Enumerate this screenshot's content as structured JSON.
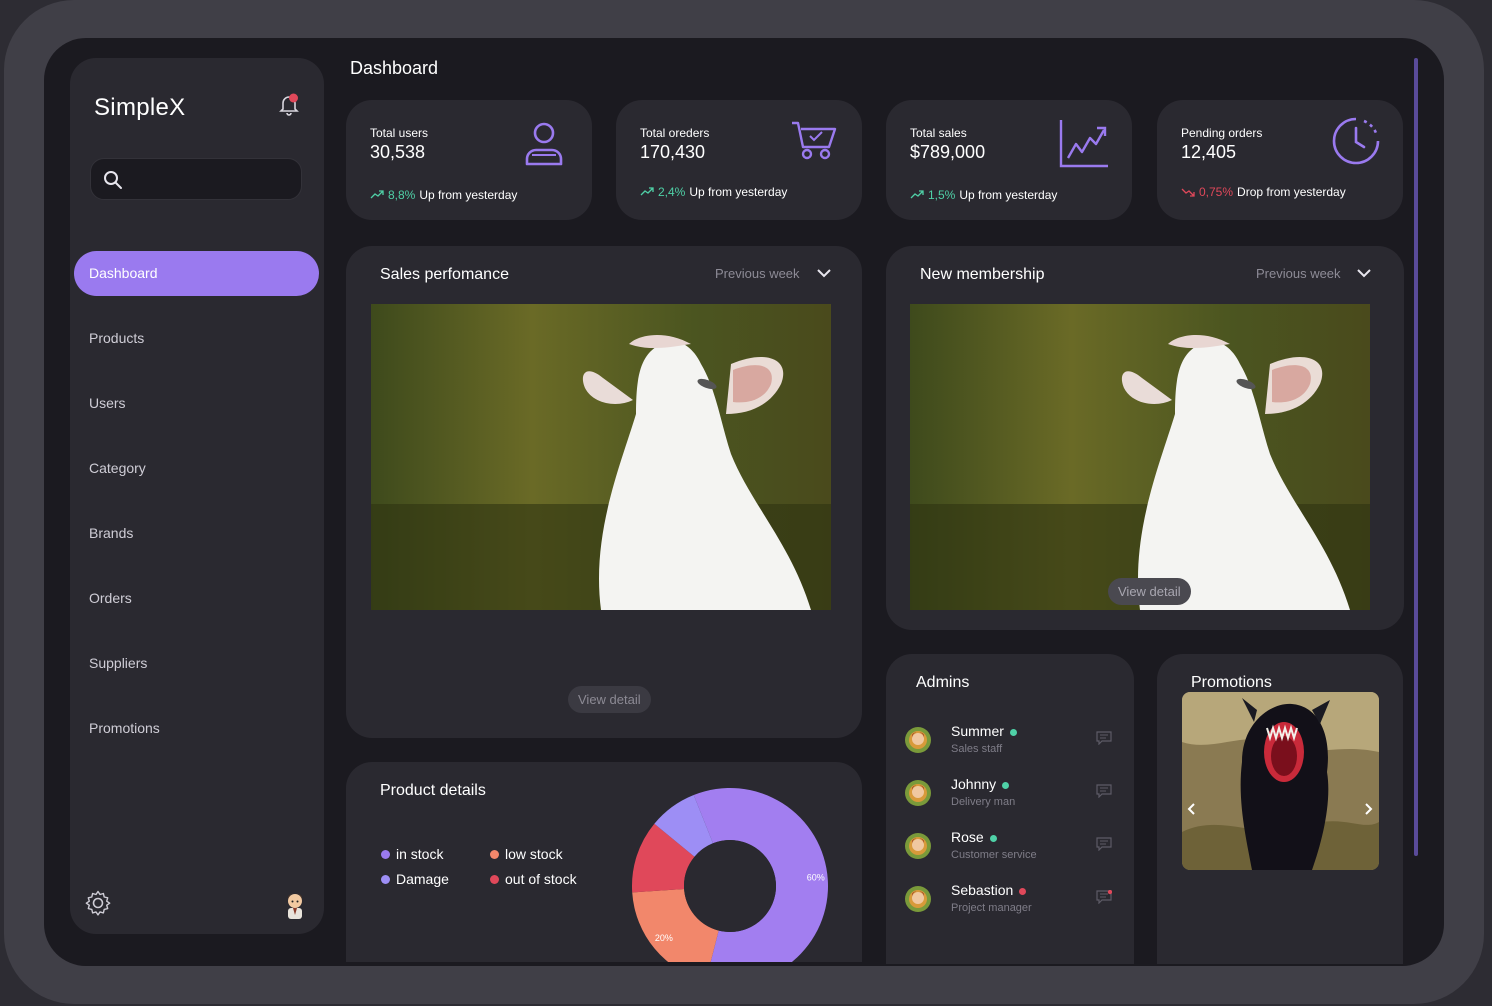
{
  "app": {
    "brand": "SimpleX",
    "page_title": "Dashboard"
  },
  "sidebar": {
    "items": [
      {
        "label": "Dashboard",
        "active": true
      },
      {
        "label": "Products"
      },
      {
        "label": "Users"
      },
      {
        "label": "Category"
      },
      {
        "label": "Brands"
      },
      {
        "label": "Orders"
      },
      {
        "label": "Suppliers"
      },
      {
        "label": "Promotions"
      }
    ],
    "search_placeholder": ""
  },
  "stats": [
    {
      "label": "Total users",
      "value": "30,538",
      "pct": "8,8%",
      "trend_text": "Up from yesterday",
      "direction": "up",
      "icon": "user-icon"
    },
    {
      "label": "Total oreders",
      "value": "170,430",
      "pct": "2,4%",
      "trend_text": "Up from yesterday",
      "direction": "up",
      "icon": "cart-icon"
    },
    {
      "label": "Total sales",
      "value": "$789,000",
      "pct": "1,5%",
      "trend_text": "Up from yesterday",
      "direction": "up",
      "icon": "chart-up-icon"
    },
    {
      "label": "Pending orders",
      "value": "12,405",
      "pct": "0,75%",
      "trend_text": "Drop from yesterday",
      "direction": "down",
      "icon": "clock-icon"
    }
  ],
  "sales": {
    "title": "Sales perfomance",
    "period": "Previous week",
    "view_detail": "View detail"
  },
  "membership": {
    "title": "New membership",
    "period": "Previous week",
    "view_detail": "View detail"
  },
  "product_details": {
    "title": "Product details",
    "legend": [
      {
        "label": "in stock",
        "color": "#9a7aef"
      },
      {
        "label": "low stock",
        "color": "#f2876b"
      },
      {
        "label": "Damage",
        "color": "#9d8ef5"
      },
      {
        "label": "out of stock",
        "color": "#e0485a"
      }
    ]
  },
  "chart_data": {
    "type": "pie",
    "categories": [
      "in stock",
      "low stock",
      "out of stock",
      "Damage"
    ],
    "values": [
      60,
      20,
      12,
      8
    ],
    "data_labels": [
      "60%",
      "20%"
    ],
    "colors": [
      "#a27ef0",
      "#f2876b",
      "#e0485a",
      "#9d8ef5"
    ]
  },
  "admins": {
    "title": "Admins",
    "rows": [
      {
        "name": "Summer",
        "role": "Sales staff",
        "status": "online",
        "status_color": "#4fd1a7"
      },
      {
        "name": "Johnny",
        "role": "Delivery man",
        "status": "online",
        "status_color": "#4fd1a7"
      },
      {
        "name": "Rose",
        "role": "Customer service",
        "status": "online",
        "status_color": "#4fd1a7"
      },
      {
        "name": "Sebastion",
        "role": "Project manager",
        "status": "offline",
        "status_color": "#e0485a"
      }
    ]
  },
  "promotions": {
    "title": "Promotions"
  },
  "colors": {
    "accent": "#9a7aef",
    "up": "#4fd1a7",
    "down": "#e0485a",
    "panel": "#2a2930",
    "bg": "#1b1a20"
  }
}
